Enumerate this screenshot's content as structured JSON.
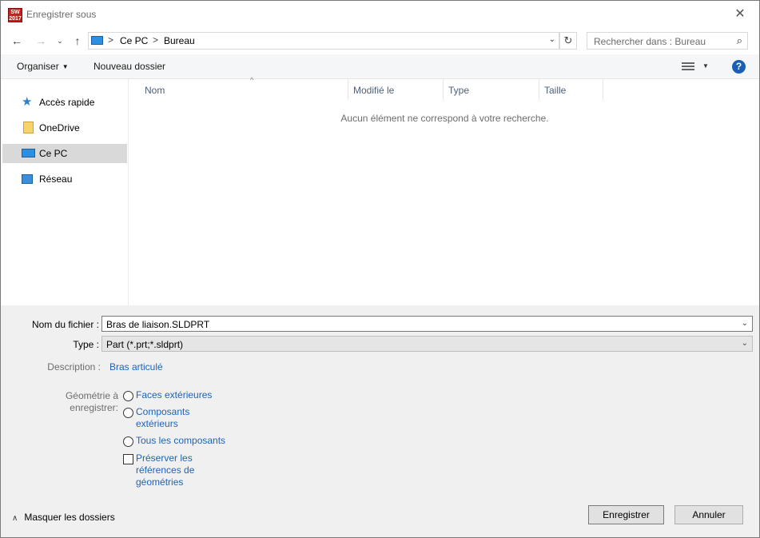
{
  "window": {
    "title": "Enregistrer sous",
    "app_badge": "2017"
  },
  "address": {
    "segments": [
      "Ce PC",
      "Bureau"
    ],
    "separator": ">"
  },
  "search": {
    "placeholder": "Rechercher dans : Bureau"
  },
  "toolbar": {
    "organize_label": "Organiser",
    "new_folder_label": "Nouveau dossier"
  },
  "nav": {
    "items": [
      {
        "label": "Accès rapide",
        "icon": "star-icon"
      },
      {
        "label": "OneDrive",
        "icon": "folder-icon"
      },
      {
        "label": "Ce PC",
        "icon": "computer-icon",
        "selected": true
      },
      {
        "label": "Réseau",
        "icon": "network-icon"
      }
    ]
  },
  "filelist": {
    "columns": [
      "Nom",
      "Modifié le",
      "Type",
      "Taille"
    ],
    "empty_message": "Aucun élément ne correspond à votre recherche."
  },
  "details": {
    "filename_label": "Nom du fichier :",
    "filename_value": "Bras de liaison.SLDPRT",
    "type_label": "Type :",
    "type_value": "Part (*.prt;*.sldprt)",
    "description_label": "Description :",
    "description_value": "Bras articulé",
    "geometry_label_1": "Géométrie à",
    "geometry_label_2": "enregistrer:",
    "options": {
      "faces": "Faces extérieures",
      "components_1": "Composants",
      "components_2": "extérieurs",
      "all_components": "Tous les composants",
      "preserve_1": "Préserver les",
      "preserve_2": "références de",
      "preserve_3": "géométries"
    }
  },
  "footer": {
    "hide_folders_label": "Masquer les dossiers",
    "save_label": "Enregistrer",
    "cancel_label": "Annuler"
  },
  "colors": {
    "link": "#1e63b6",
    "selection": "#d9d9d9",
    "details_bg": "#f0f0f0"
  }
}
